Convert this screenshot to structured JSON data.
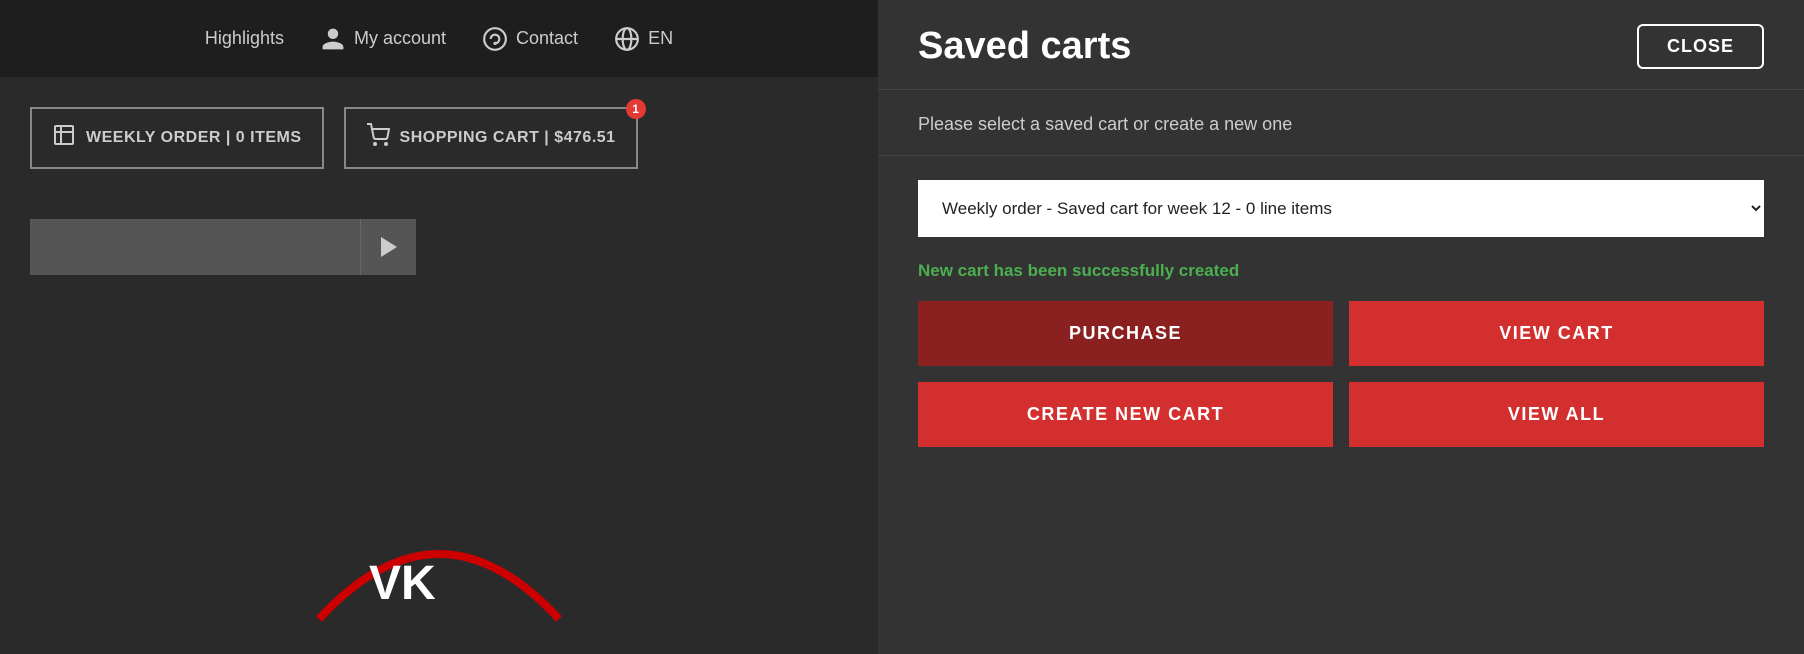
{
  "nav": {
    "highlights": "Highlights",
    "my_account": "My account",
    "contact": "Contact",
    "language": "EN"
  },
  "cart_buttons": {
    "weekly_order": "WEEKLY ORDER | 0 ITEMS",
    "shopping_cart": "SHOPPING CART | $476.51",
    "badge_count": "1"
  },
  "saved_carts_panel": {
    "title": "Saved carts",
    "close_label": "CLOSE",
    "subtitle": "Please select a saved cart or create a new one",
    "dropdown_option": "Weekly order - Saved cart for week 12 - 0 line items",
    "success_message": "New cart has been successfully created",
    "purchase_label": "PURCHASE",
    "view_cart_label": "VIEW CART",
    "create_new_cart_label": "CREATE NEW CART",
    "view_all_label": "VIEW ALL"
  }
}
